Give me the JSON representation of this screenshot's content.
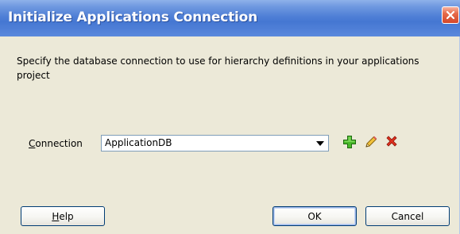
{
  "dialog": {
    "title": "Initialize Applications Connection",
    "description": "Specify the database connection to use for hierarchy definitions in your applications project",
    "connection": {
      "label_mnemonic": "C",
      "label_rest": "onnection",
      "selected_value": "ApplicationDB"
    },
    "icons": {
      "close": "close-icon",
      "add": "add-icon",
      "edit": "pencil-icon",
      "delete": "delete-icon",
      "dropdown": "chevron-down-icon"
    },
    "buttons": {
      "help_mnemonic": "H",
      "help_rest": "elp",
      "ok": "OK",
      "cancel": "Cancel"
    },
    "colors": {
      "titlebar": "#4f7fd6",
      "close_button": "#d4462a",
      "dialog_background": "#ece9d8",
      "add_icon": "#3a9a1e",
      "edit_icon": "#c89a1a",
      "delete_icon": "#d42a1a"
    }
  }
}
